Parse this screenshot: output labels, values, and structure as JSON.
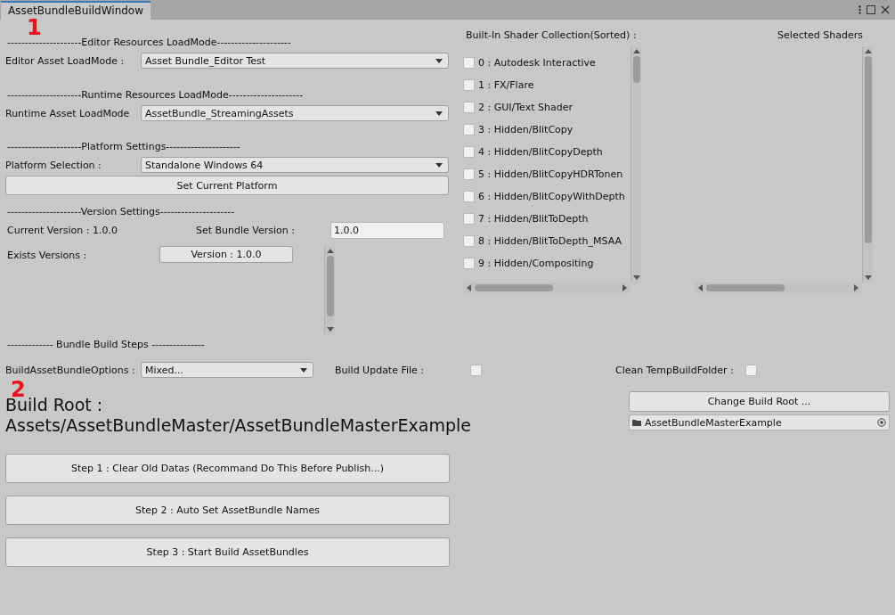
{
  "window": {
    "tab": "AssetBundleBuildWindow"
  },
  "load_sections": [
    {
      "marker": "1",
      "header": "---------------------Editor Resources LoadMode---------------------",
      "label": "Editor Asset LoadMode :",
      "value": "Asset Bundle_Editor Test"
    },
    {
      "header": "---------------------Runtime Resources LoadMode---------------------",
      "label": "Runtime Asset LoadMode",
      "value": "AssetBundle_StreamingAssets"
    },
    {
      "header": "---------------------Platform Settings---------------------",
      "label": "Platform Selection :",
      "value": "Standalone Windows 64",
      "button": "Set Current Platform"
    }
  ],
  "version": {
    "header": "---------------------Version Settings---------------------",
    "current": "Current Version : 1.0.0",
    "set_label": "Set Bundle Version :",
    "set_value": "1.0.0",
    "exists_label": "Exists Versions :",
    "versions": [
      "Version : 1.0.0"
    ]
  },
  "shaders": {
    "title": "Built-In Shader Collection(Sorted) :",
    "selected_title": "Selected Shaders",
    "items": [
      {
        "label": "0 : Autodesk Interactive",
        "checked": false
      },
      {
        "label": "1 : FX/Flare",
        "checked": false
      },
      {
        "label": "2 : GUI/Text Shader",
        "checked": false
      },
      {
        "label": "3 : Hidden/BlitCopy",
        "checked": false
      },
      {
        "label": "4 : Hidden/BlitCopyDepth",
        "checked": false
      },
      {
        "label": "5 : Hidden/BlitCopyHDRTonen",
        "checked": false
      },
      {
        "label": "6 : Hidden/BlitCopyWithDepth",
        "checked": false
      },
      {
        "label": "7 : Hidden/BlitToDepth",
        "checked": false
      },
      {
        "label": "8 : Hidden/BlitToDepth_MSAA",
        "checked": false
      },
      {
        "label": "9 : Hidden/Compositing",
        "checked": false
      }
    ]
  },
  "build_steps": {
    "header": "------------- Bundle Build Steps ---------------",
    "options_label": "BuildAssetBundleOptions :",
    "options_value": "Mixed...",
    "update_label": "Build Update File :",
    "update_checked": false,
    "clean_label": "Clean TempBuildFolder :",
    "clean_checked": false
  },
  "build_root": {
    "marker": "2",
    "title": "Build Root :",
    "path": "Assets/AssetBundleMaster/AssetBundleMasterExample",
    "change_button": "Change Build Root ...",
    "folder": "AssetBundleMasterExample"
  },
  "steps": [
    "Step 1 : Clear Old Datas (Recommand Do This Before Publish...)",
    "Step 2 : Auto Set AssetBundle Names",
    "Step 3 : Start Build AssetBundles"
  ]
}
